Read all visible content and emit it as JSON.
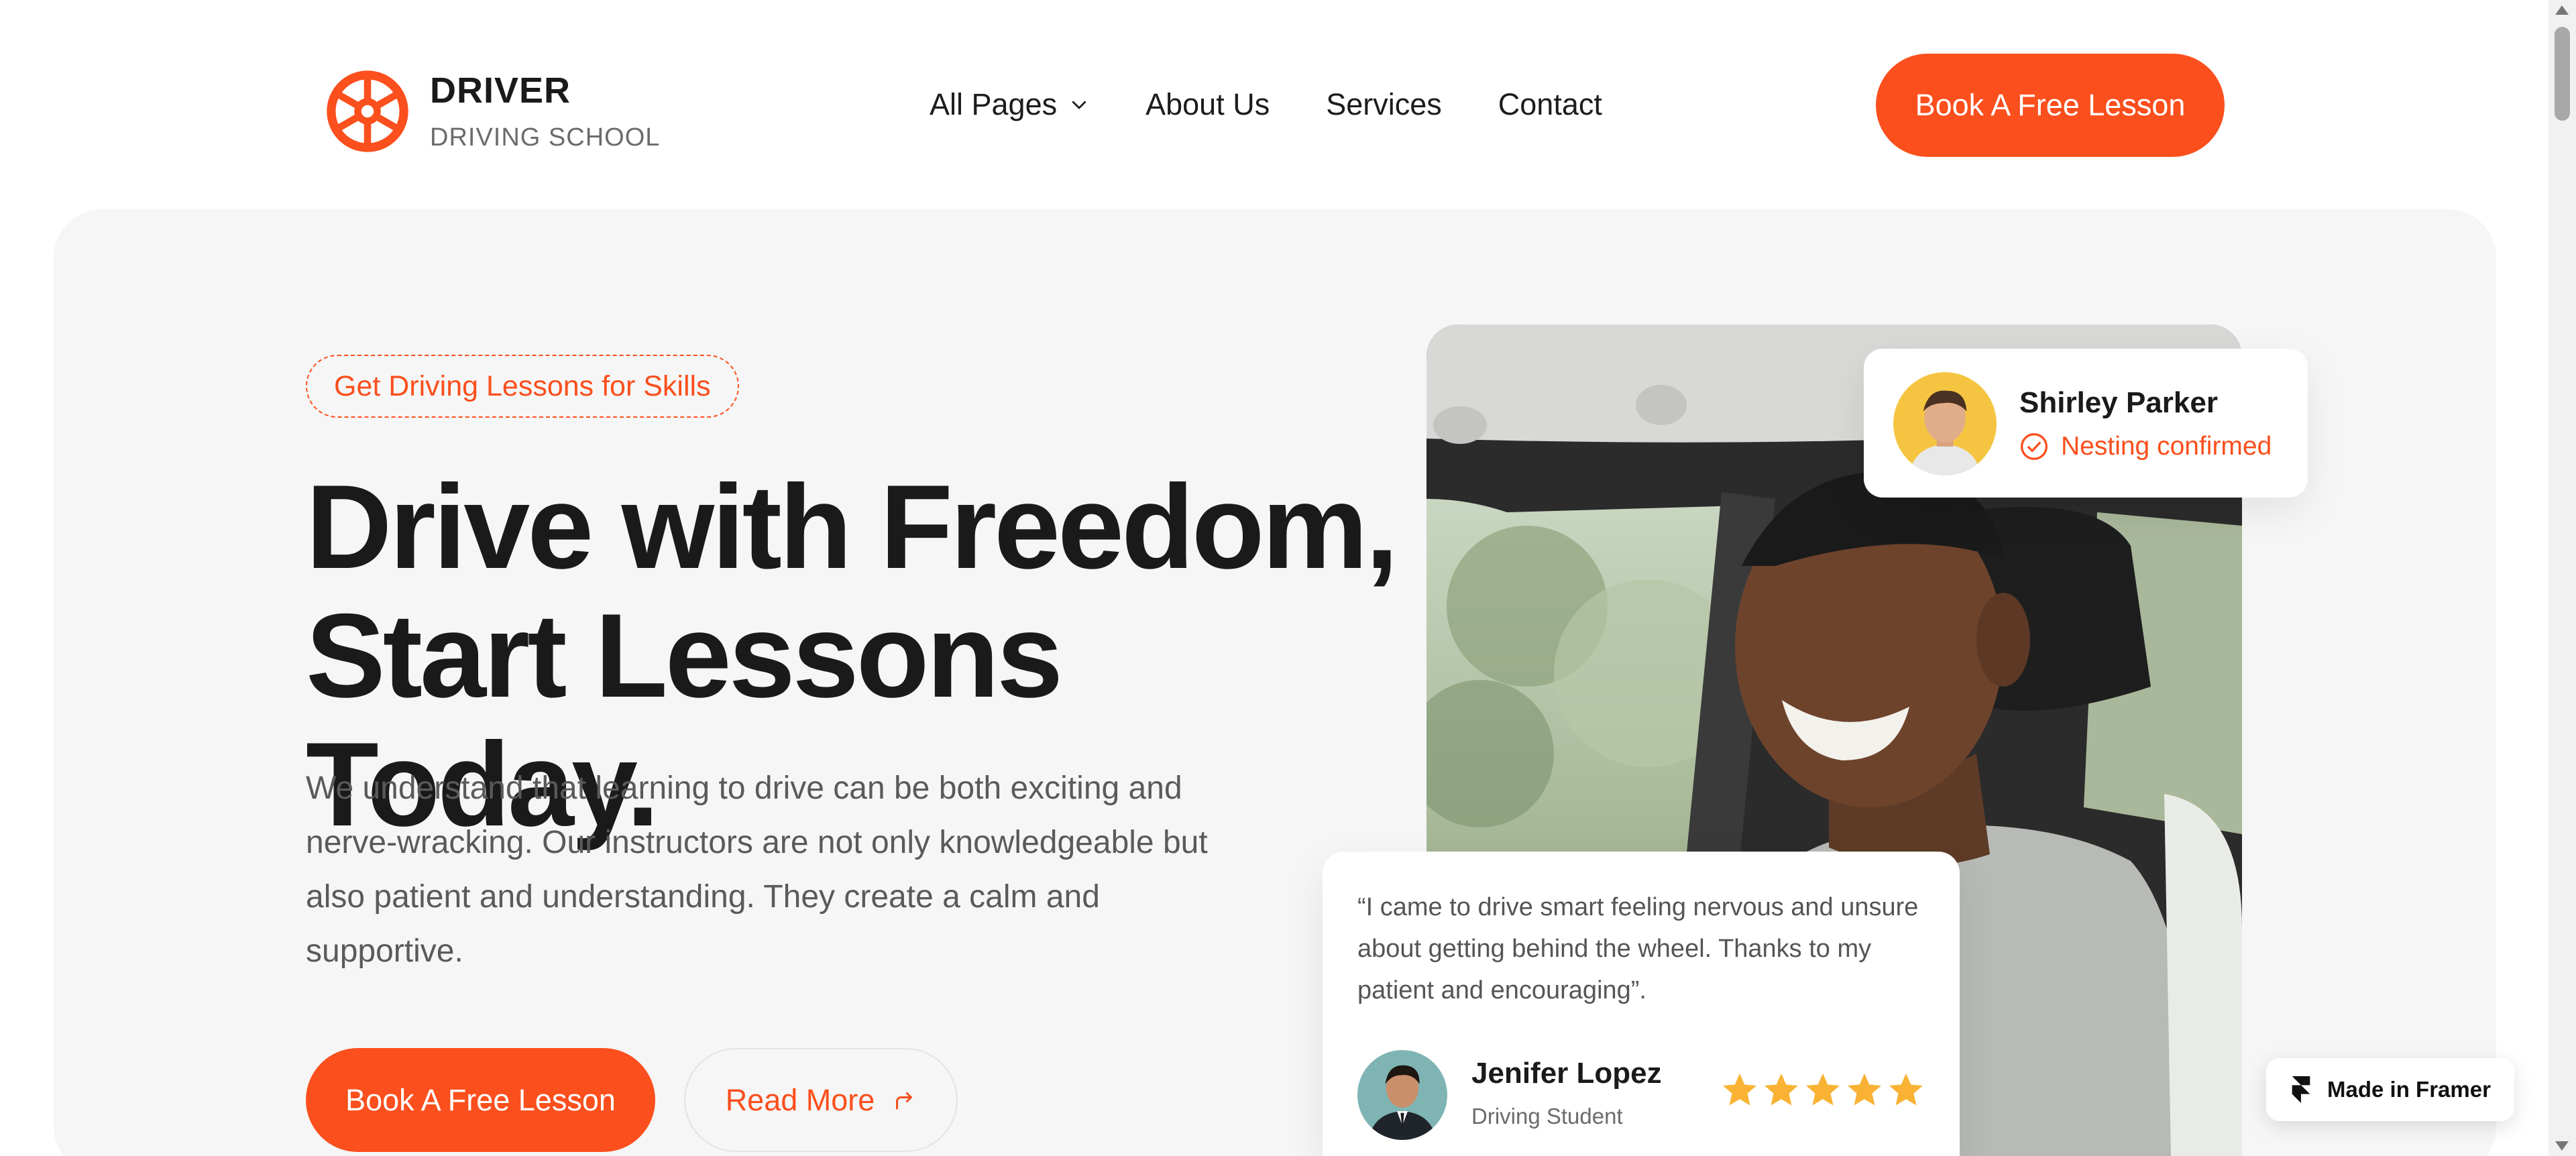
{
  "brand": {
    "name": "DRIVER",
    "tagline": "DRIVING SCHOOL",
    "accent_color": "#fb4f1d",
    "icon": "steering-wheel-icon"
  },
  "nav": {
    "items": [
      {
        "label": "All Pages",
        "has_dropdown": true
      },
      {
        "label": "About Us"
      },
      {
        "label": "Services"
      },
      {
        "label": "Contact"
      }
    ],
    "cta_label": "Book A Free Lesson"
  },
  "hero": {
    "tag": "Get Driving Lessons for Skills",
    "headline_line1": "Drive with Freedom,",
    "headline_line2": "Start Lessons Today.",
    "description": "We understand that learning to drive can be both exciting and nerve-wracking. Our instructors are not only knowledgeable but also patient and understanding. They create a calm and supportive.",
    "primary_cta": "Book A Free Lesson",
    "secondary_cta": "Read More",
    "secondary_icon": "arrow-turn-right-icon"
  },
  "user_card": {
    "name": "Shirley Parker",
    "status": "Nesting confirmed",
    "status_icon": "check-circle-icon"
  },
  "review": {
    "quote": "“I came to drive smart feeling nervous and unsure about getting behind the wheel. Thanks to my patient and encouraging”.",
    "name": "Jenifer Lopez",
    "role": "Driving Student",
    "rating": 5,
    "star_color": "#f9b233"
  },
  "badge": {
    "label": "Made in Framer",
    "icon": "framer-logo-icon"
  }
}
